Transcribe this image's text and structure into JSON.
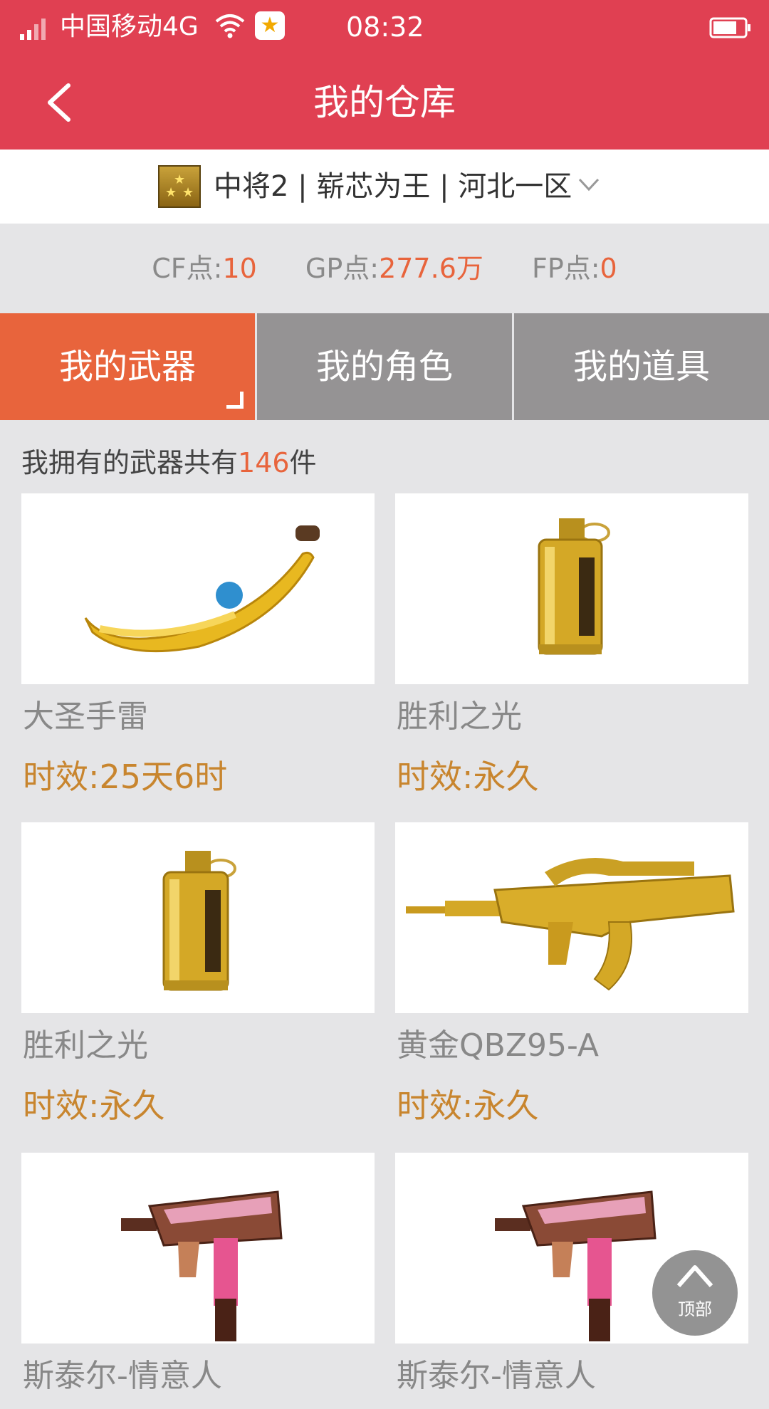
{
  "status_bar": {
    "carrier": "中国移动4G",
    "time": "08:32",
    "app_icon": "star-app-icon"
  },
  "nav": {
    "title": "我的仓库",
    "back_icon": "chevron-left-icon"
  },
  "account": {
    "name": "中将2 | 崭芯为王 | 河北一区",
    "badge_icon": "rank-badge-icon",
    "dropdown_icon": "chevron-down-icon"
  },
  "points": [
    {
      "label": "CF点:",
      "value": "10"
    },
    {
      "label": "GP点:",
      "value": "277.6万"
    },
    {
      "label": "FP点:",
      "value": "0"
    }
  ],
  "tabs": [
    {
      "label": "我的武器",
      "active": true
    },
    {
      "label": "我的角色",
      "active": false
    },
    {
      "label": "我的道具",
      "active": false
    }
  ],
  "summary": {
    "prefix": "我拥有的武器共有",
    "count": "146",
    "suffix": "件"
  },
  "items": [
    {
      "name": "大圣手雷",
      "duration": "时效:25天6时",
      "image": "banana-grenade-image"
    },
    {
      "name": "胜利之光",
      "duration": "时效:永久",
      "image": "gold-flashbang-image"
    },
    {
      "name": "胜利之光",
      "duration": "时效:永久",
      "image": "gold-flashbang-image"
    },
    {
      "name": "黄金QBZ95-A",
      "duration": "时效:永久",
      "image": "gold-rifle-image"
    },
    {
      "name": "斯泰尔-情意人",
      "duration": "",
      "image": "pink-smg-image"
    },
    {
      "name": "斯泰尔-情意人",
      "duration": "",
      "image": "pink-smg-image"
    }
  ],
  "back_to_top": {
    "label": "顶部",
    "icon": "chevron-up-icon"
  },
  "colors": {
    "header_red": "#e04052",
    "accent_orange": "#e8643c",
    "tab_gray": "#959394",
    "duration_gold": "#c8852e"
  }
}
